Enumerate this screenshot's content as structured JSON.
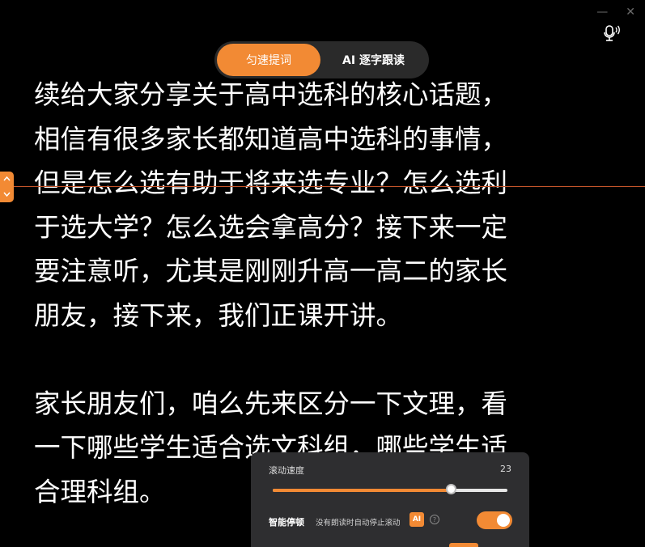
{
  "window": {
    "minimize_glyph": "—",
    "close_glyph": "✕"
  },
  "mode_toggle": {
    "tabs": [
      {
        "label": "匀速提词",
        "active": true
      },
      {
        "label": "AI 逐字跟读",
        "active": false
      }
    ]
  },
  "script": {
    "lines": [
      "续给大家分享关于高中选科的核心话题，",
      "相信有很多家长都知道高中选科的事情，",
      "但是怎么选有助于将来选专业？怎么选利",
      "于选大学？怎么选会拿高分？接下来一定",
      "要注意听，尤其是刚刚升高一高二的家长",
      "朋友，接下来，我们正课开讲。",
      "",
      "家长朋友们，咱么先来区分一下文理，看",
      "一下哪些学生适合选文科组，哪些学生适",
      "合理科组。"
    ]
  },
  "control_panel": {
    "speed_label": "滚动速度",
    "speed_value": "23",
    "speed_fraction": 0.76,
    "smart_pause_label": "智能停顿",
    "smart_pause_desc": "没有朗读时自动停止滚动",
    "ai_badge": "AI",
    "help_glyph": "?",
    "smart_pause_on": true
  },
  "colors": {
    "accent": "#f28a34",
    "panel_bg": "#2e2e30",
    "toggle_bg": "#2a2a2a",
    "reading_line": "#c2542a"
  },
  "icons": [
    "minimize-icon",
    "close-icon",
    "microphone-icon",
    "up-arrow-icon",
    "down-arrow-icon",
    "help-icon"
  ]
}
